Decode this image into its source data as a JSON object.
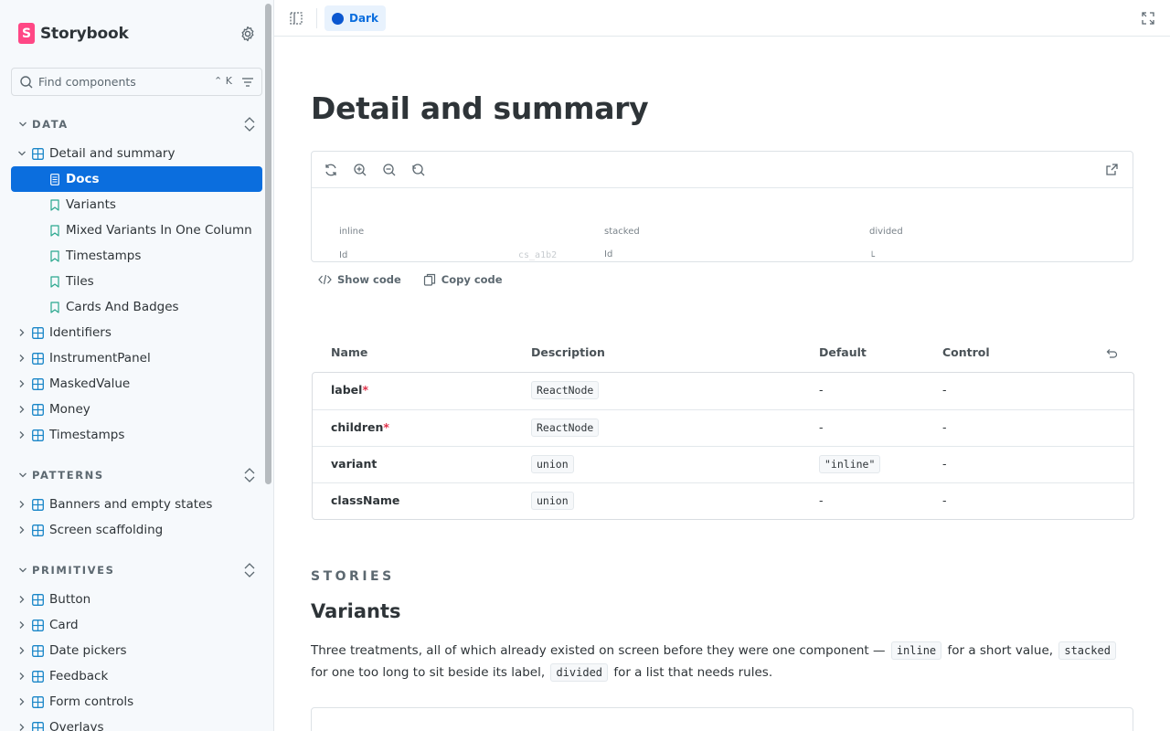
{
  "brand": {
    "name": "Storybook"
  },
  "search": {
    "placeholder": "Find components",
    "shortcut": "⌃ K"
  },
  "sidebar": {
    "sections": [
      {
        "title": "DATA"
      },
      {
        "title": "PATTERNS"
      },
      {
        "title": "PRIMITIVES"
      }
    ],
    "data_items": [
      {
        "label": "Detail and summary"
      },
      {
        "label": "Docs"
      },
      {
        "label": "Variants"
      },
      {
        "label": "Mixed Variants In One Column"
      },
      {
        "label": "Timestamps"
      },
      {
        "label": "Tiles"
      },
      {
        "label": "Cards And Badges"
      },
      {
        "label": "Identifiers"
      },
      {
        "label": "InstrumentPanel"
      },
      {
        "label": "MaskedValue"
      },
      {
        "label": "Money"
      },
      {
        "label": "Timestamps"
      }
    ],
    "pattern_items": [
      {
        "label": "Banners and empty states"
      },
      {
        "label": "Screen scaffolding"
      }
    ],
    "primitive_items": [
      {
        "label": "Button"
      },
      {
        "label": "Card"
      },
      {
        "label": "Date pickers"
      },
      {
        "label": "Feedback"
      },
      {
        "label": "Form controls"
      },
      {
        "label": "Overlays"
      }
    ]
  },
  "toolbar": {
    "theme_label": "Dark",
    "theme_color": "#0b57d0"
  },
  "page": {
    "title": "Detail and summary"
  },
  "preview": {
    "columns": [
      "inline",
      "stacked",
      "divided"
    ],
    "row_labels": [
      "Id",
      "Id"
    ],
    "faded_value": "cs_a1b2",
    "divided_fragment": "└"
  },
  "code_actions": {
    "show_code": "Show code",
    "copy_code": "Copy code"
  },
  "props": {
    "headers": {
      "name": "Name",
      "description": "Description",
      "default": "Default",
      "control": "Control"
    },
    "rows": [
      {
        "name": "label",
        "required": "*",
        "type": "ReactNode",
        "default": "-",
        "control": "-"
      },
      {
        "name": "children",
        "required": "*",
        "type": "ReactNode",
        "default": "-",
        "control": "-"
      },
      {
        "name": "variant",
        "required": "",
        "type": "union",
        "default": "\"inline\"",
        "control": "-"
      },
      {
        "name": "className",
        "required": "",
        "type": "union",
        "default": "-",
        "control": "-"
      }
    ]
  },
  "stories": {
    "heading": "STORIES",
    "first_title": "Variants",
    "desc": {
      "part1": "Three treatments, all of which already existed on screen before they were one component —",
      "code1": "inline",
      "part2": "for a short value,",
      "code2": "stacked",
      "part3": "for one too long to sit beside its label,",
      "code3": "divided",
      "part4": "for a list that needs rules."
    }
  },
  "colors": {
    "accent": "#0b6ede",
    "brand": "#ff4785",
    "required": "#e0314a"
  }
}
